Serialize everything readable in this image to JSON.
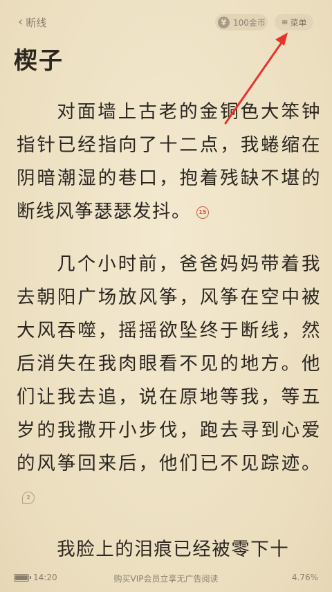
{
  "header": {
    "back_label": "断线",
    "coins_label": "100金币",
    "coin_icon_glyph": "¥",
    "menu_label": "菜单",
    "menu_icon": "≡"
  },
  "chapter": {
    "title": "楔子",
    "paragraphs": [
      {
        "text": "对面墙上古老的金铜色大笨钟指针已经指向了十二点，我蜷缩在阴暗潮湿的巷口，抱着残缺不堪的断线风筝瑟瑟发抖。",
        "comment_count": "15"
      },
      {
        "text": "几个小时前，爸爸妈妈带着我去朝阳广场放风筝，风筝在空中被大风吞噬，摇摇欲坠终于断线，然后消失在我肉眼看不见的地方。他们让我去追，说在原地等我，等五岁的我撒开小步伐，跑去寻到心爱的风筝回来后，他们已不见踪迹。",
        "comment_count": "2"
      },
      {
        "text": "我脸上的泪痕已经被零下十",
        "comment_count": ""
      }
    ]
  },
  "footer": {
    "time": "14:20",
    "promo": "购买VIP会员立享无广告阅读",
    "progress": "4.76%",
    "battery_level": 1.0
  },
  "colors": {
    "background": "#efe3c6",
    "text": "#2b2620",
    "muted": "#8a7f6e",
    "comment_hot": "#c85a45",
    "annotation_arrow": "#e8322a"
  }
}
